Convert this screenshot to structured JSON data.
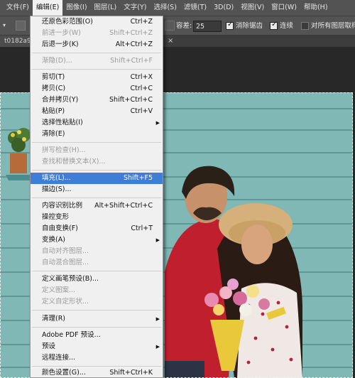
{
  "menubar": {
    "items": [
      "文件(F)",
      "编辑(E)",
      "图像(I)",
      "图层(L)",
      "文字(Y)",
      "选择(S)",
      "滤镜(T)",
      "3D(D)",
      "视图(V)",
      "窗口(W)",
      "帮助(H)"
    ]
  },
  "options": {
    "tolerance_label": "容差:",
    "tolerance_value": "25",
    "antialias_label": "消除锯齿",
    "contiguous_label": "连续",
    "sample_all_label": "对所有图层取样"
  },
  "document": {
    "tab_title": "t0182a9",
    "close_glyph": "×"
  },
  "edit_menu": {
    "items": [
      {
        "label": "还原色彩范围(O)",
        "shortcut": "Ctrl+Z",
        "enabled": true
      },
      {
        "label": "前进一步(W)",
        "shortcut": "Shift+Ctrl+Z",
        "enabled": false
      },
      {
        "label": "后退一步(K)",
        "shortcut": "Alt+Ctrl+Z",
        "enabled": true
      },
      {
        "label": "渐隐(D)...",
        "shortcut": "Shift+Ctrl+F",
        "enabled": false
      },
      {
        "label": "剪切(T)",
        "shortcut": "Ctrl+X",
        "enabled": true
      },
      {
        "label": "拷贝(C)",
        "shortcut": "Ctrl+C",
        "enabled": true
      },
      {
        "label": "合并拷贝(Y)",
        "shortcut": "Shift+Ctrl+C",
        "enabled": true
      },
      {
        "label": "粘贴(P)",
        "shortcut": "Ctrl+V",
        "enabled": true
      },
      {
        "label": "选择性粘贴(I)",
        "shortcut": "",
        "enabled": true,
        "submenu": true
      },
      {
        "label": "清除(E)",
        "shortcut": "",
        "enabled": true
      },
      {
        "label": "拼写检查(H)...",
        "shortcut": "",
        "enabled": false
      },
      {
        "label": "查找和替换文本(X)...",
        "shortcut": "",
        "enabled": false
      },
      {
        "label": "填充(L)...",
        "shortcut": "Shift+F5",
        "enabled": true,
        "highlighted": true
      },
      {
        "label": "描边(S)...",
        "shortcut": "",
        "enabled": true
      },
      {
        "label": "内容识别比例",
        "shortcut": "Alt+Shift+Ctrl+C",
        "enabled": true
      },
      {
        "label": "操控变形",
        "shortcut": "",
        "enabled": true
      },
      {
        "label": "自由变换(F)",
        "shortcut": "Ctrl+T",
        "enabled": true
      },
      {
        "label": "变换(A)",
        "shortcut": "",
        "enabled": true,
        "submenu": true
      },
      {
        "label": "自动对齐图层...",
        "shortcut": "",
        "enabled": false
      },
      {
        "label": "自动混合图层...",
        "shortcut": "",
        "enabled": false
      },
      {
        "label": "定义画笔预设(B)...",
        "shortcut": "",
        "enabled": true
      },
      {
        "label": "定义图案...",
        "shortcut": "",
        "enabled": false
      },
      {
        "label": "定义自定形状...",
        "shortcut": "",
        "enabled": false
      },
      {
        "label": "清理(R)",
        "shortcut": "",
        "enabled": true,
        "submenu": true
      },
      {
        "label": "Adobe PDF 预设...",
        "shortcut": "",
        "enabled": true
      },
      {
        "label": "预设",
        "shortcut": "",
        "enabled": true,
        "submenu": true
      },
      {
        "label": "远程连接...",
        "shortcut": "",
        "enabled": true
      },
      {
        "label": "颜色设置(G)...",
        "shortcut": "Shift+Ctrl+K",
        "enabled": true
      }
    ]
  },
  "colors": {
    "menu_highlight": "#3f7dd6",
    "photo_wall": "#7fb8b5",
    "chrome": "#535353"
  }
}
